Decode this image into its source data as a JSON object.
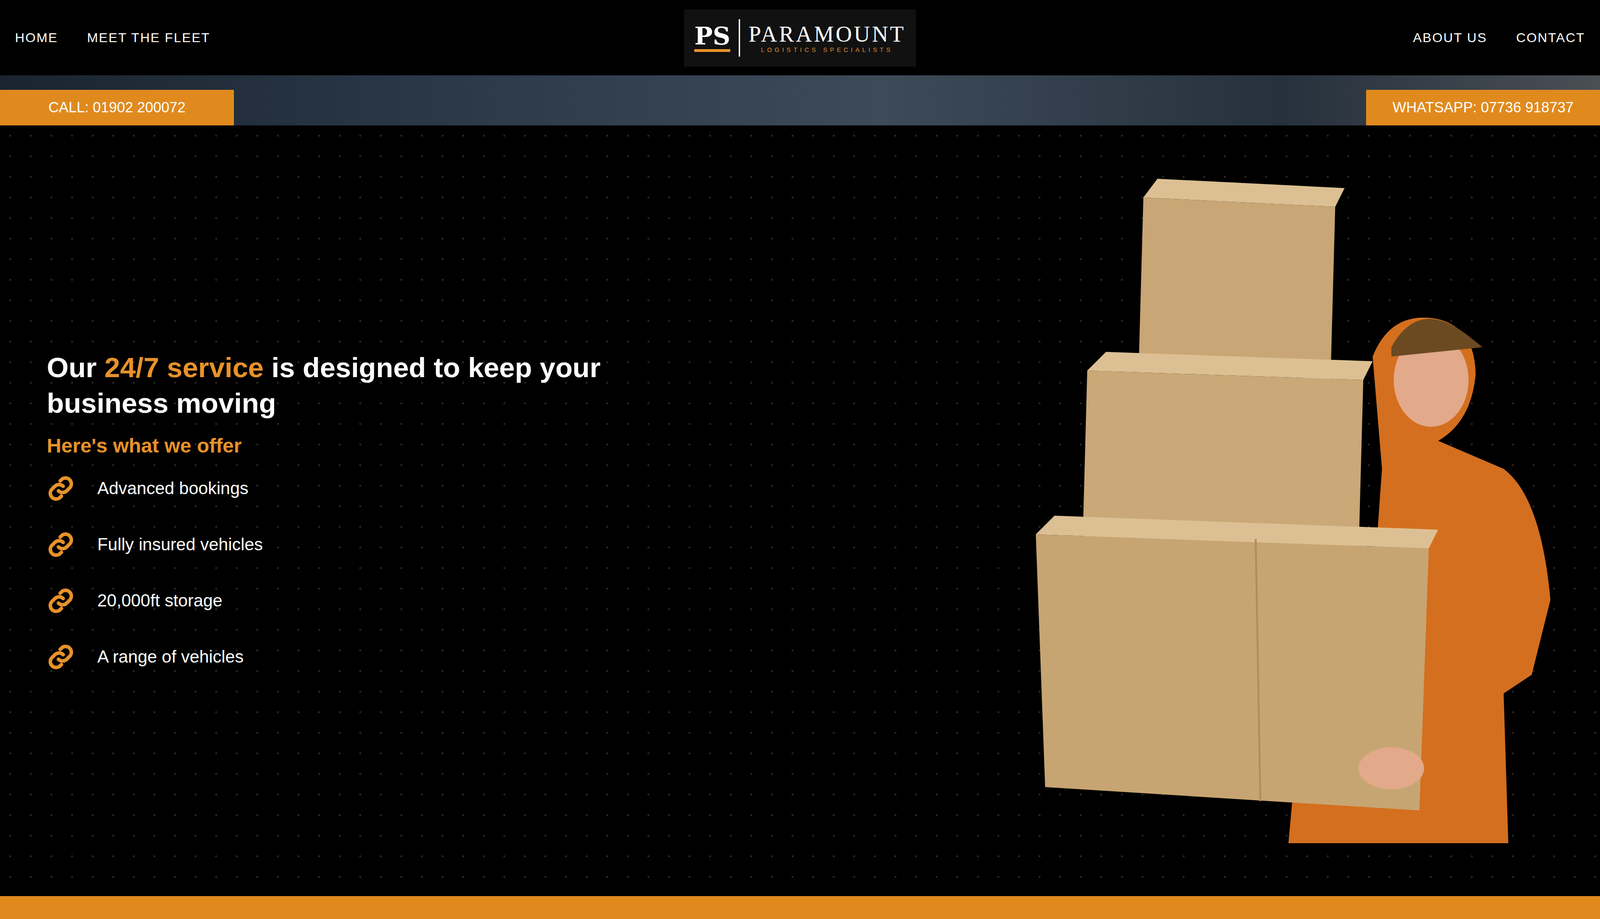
{
  "nav": {
    "left": [
      {
        "label": "HOME"
      },
      {
        "label": "MEET THE FLEET"
      }
    ],
    "right": [
      {
        "label": "ABOUT US"
      },
      {
        "label": "CONTACT"
      }
    ]
  },
  "logo": {
    "mark": "PS",
    "name": "PARAMOUNT",
    "tagline": "LOGISTICS SPECIALISTS"
  },
  "contact_bar": {
    "call": "CALL: 01902 200072",
    "whatsapp": "WHATSAPP: 07736 918737"
  },
  "hero": {
    "heading_before": "Our ",
    "heading_highlight": "24/7 service",
    "heading_after": " is designed to keep your business moving",
    "subheading": "Here's what we offer",
    "offers": [
      "Advanced bookings",
      "Fully insured vehicles",
      "20,000ft storage",
      "A range of vehicles"
    ]
  }
}
